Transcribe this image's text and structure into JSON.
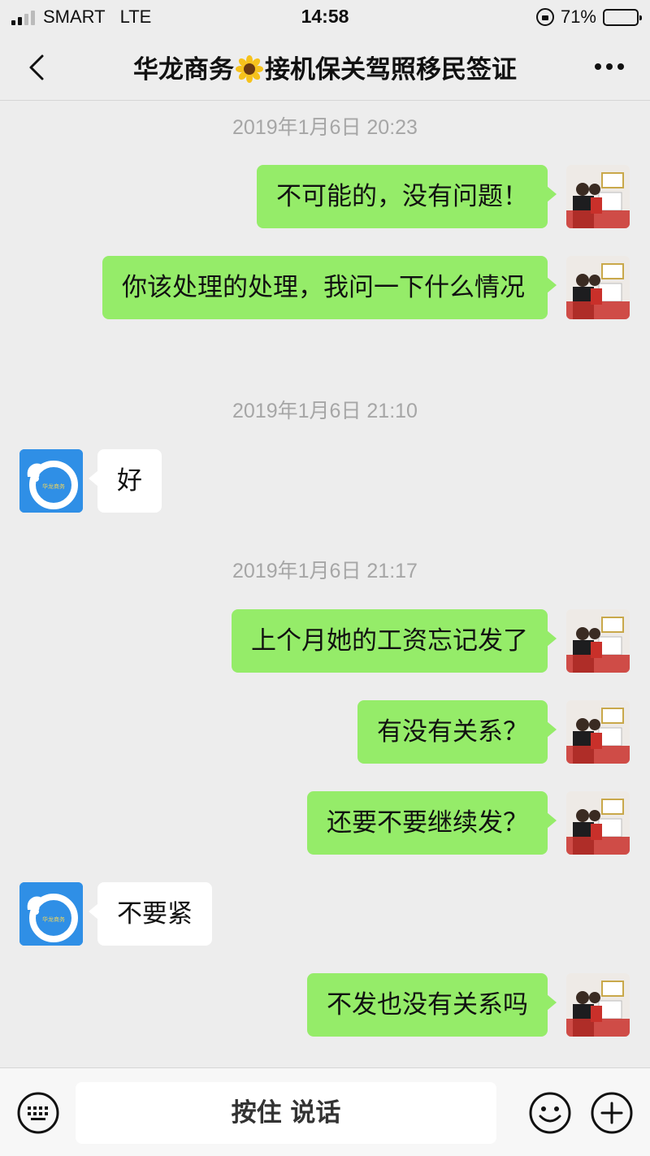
{
  "status_bar": {
    "carrier": "SMART",
    "network": "LTE",
    "time": "14:58",
    "battery": "71%",
    "battery_level": 0.71
  },
  "nav": {
    "title_part1": "华龙商务",
    "title_part2": "接机保关驾照移民签证",
    "title_emoji": "sunflower-icon"
  },
  "chat": {
    "timestamps": [
      "2019年1月6日 20:23",
      "2019年1月6日 21:10",
      "2019年1月6日 21:17"
    ],
    "messages": [
      {
        "side": "me",
        "text": "不可能的，没有问题！"
      },
      {
        "side": "me",
        "text": "你该处理的处理，我问一下什么情况"
      },
      {
        "side": "them",
        "text": "好"
      },
      {
        "side": "me",
        "text": "上个月她的工资忘记发了"
      },
      {
        "side": "me",
        "text": "有没有关系？"
      },
      {
        "side": "me",
        "text": "还要不要继续发？"
      },
      {
        "side": "them",
        "text": "不要紧"
      },
      {
        "side": "me",
        "text": "不发也没有关系吗"
      }
    ]
  },
  "input_bar": {
    "voice_label": "按住 说话",
    "icons": [
      "keyboard-icon",
      "emoji-icon",
      "plus-icon"
    ]
  },
  "colors": {
    "background": "#ededed",
    "my_bubble": "#95ec69",
    "their_bubble": "#ffffff",
    "timestamp": "#a6a6a6"
  }
}
